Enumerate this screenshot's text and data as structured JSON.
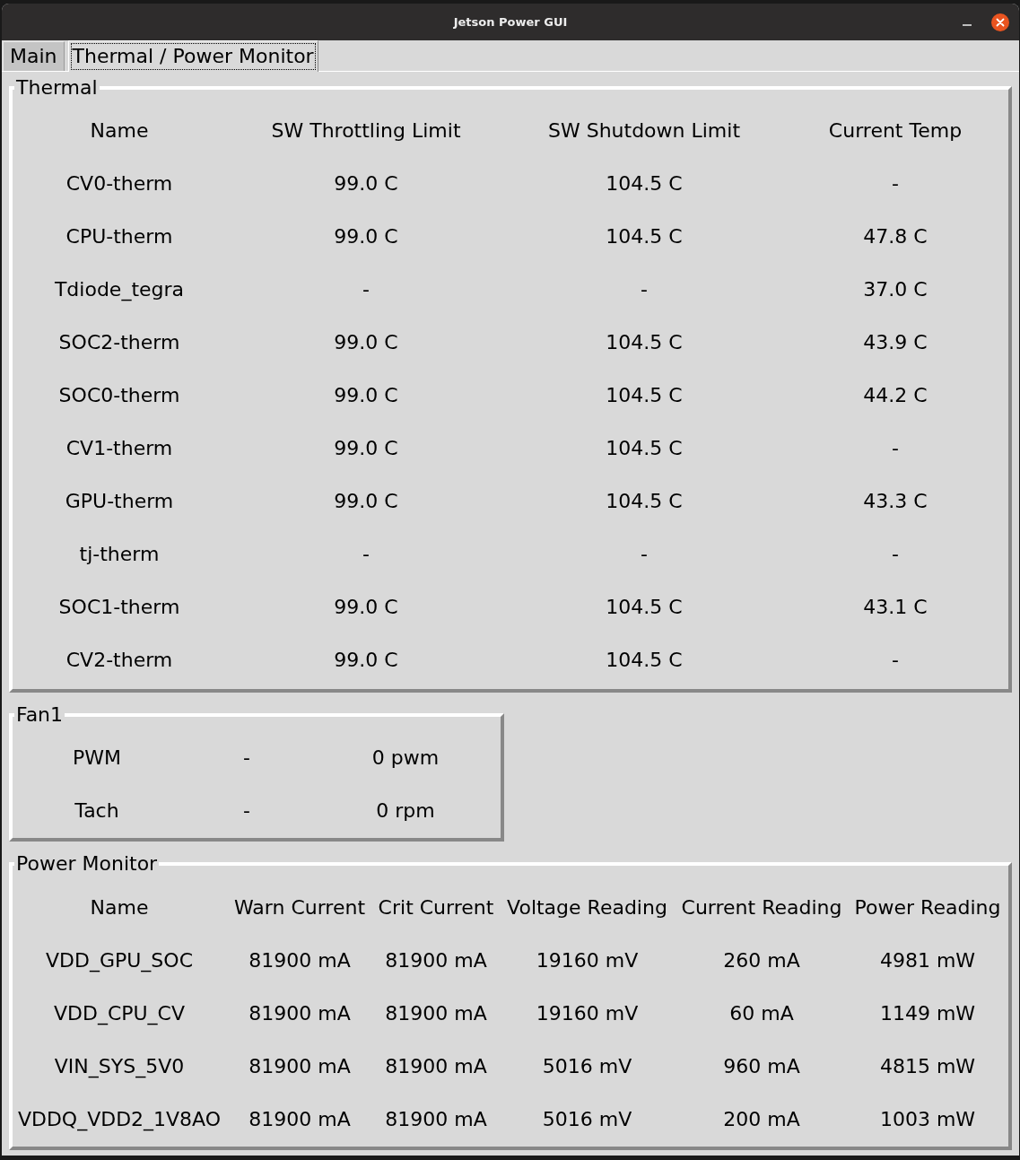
{
  "window": {
    "title": "Jetson Power GUI"
  },
  "tabs": [
    {
      "label": "Main",
      "selected": false
    },
    {
      "label": "Thermal / Power Monitor",
      "selected": true
    }
  ],
  "thermal": {
    "title": "Thermal",
    "columns": [
      "Name",
      "SW Throttling Limit",
      "SW Shutdown Limit",
      "Current Temp"
    ],
    "rows": [
      [
        "CV0-therm",
        "99.0 C",
        "104.5 C",
        "-"
      ],
      [
        "CPU-therm",
        "99.0 C",
        "104.5 C",
        "47.8 C"
      ],
      [
        "Tdiode_tegra",
        "-",
        "-",
        "37.0 C"
      ],
      [
        "SOC2-therm",
        "99.0 C",
        "104.5 C",
        "43.9 C"
      ],
      [
        "SOC0-therm",
        "99.0 C",
        "104.5 C",
        "44.2 C"
      ],
      [
        "CV1-therm",
        "99.0 C",
        "104.5 C",
        "-"
      ],
      [
        "GPU-therm",
        "99.0 C",
        "104.5 C",
        "43.3 C"
      ],
      [
        "tj-therm",
        "-",
        "-",
        "-"
      ],
      [
        "SOC1-therm",
        "99.0 C",
        "104.5 C",
        "43.1 C"
      ],
      [
        "CV2-therm",
        "99.0 C",
        "104.5 C",
        "-"
      ]
    ]
  },
  "fan": {
    "title": "Fan1",
    "rows": [
      [
        "PWM",
        "-",
        "0 pwm"
      ],
      [
        "Tach",
        "-",
        "0 rpm"
      ]
    ]
  },
  "power_monitor": {
    "title": "Power Monitor",
    "columns": [
      "Name",
      "Warn Current",
      "Crit Current",
      "Voltage Reading",
      "Current Reading",
      "Power Reading"
    ],
    "rows": [
      [
        "VDD_GPU_SOC",
        "81900 mA",
        "81900 mA",
        "19160 mV",
        "260 mA",
        "4981 mW"
      ],
      [
        "VDD_CPU_CV",
        "81900 mA",
        "81900 mA",
        "19160 mV",
        "60 mA",
        "1149 mW"
      ],
      [
        "VIN_SYS_5V0",
        "81900 mA",
        "81900 mA",
        "5016 mV",
        "960 mA",
        "4815 mW"
      ],
      [
        "VDDQ_VDD2_1V8AO",
        "81900 mA",
        "81900 mA",
        "5016 mV",
        "200 mA",
        "1003 mW"
      ]
    ]
  }
}
